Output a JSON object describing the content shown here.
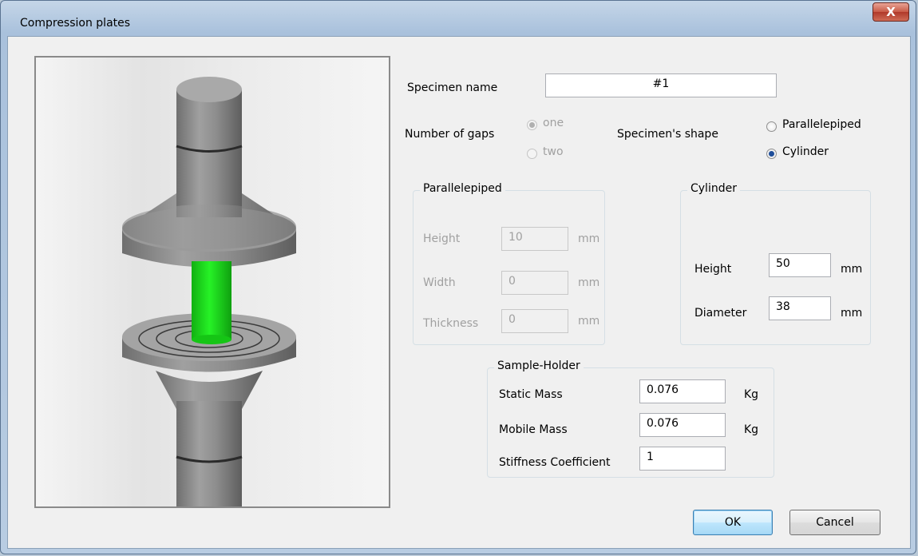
{
  "window": {
    "title": "Compression plates",
    "close_label": "X"
  },
  "specimen": {
    "label": "Specimen name",
    "value": "#1"
  },
  "gaps": {
    "label": "Number of gaps",
    "options": [
      "one",
      "two"
    ],
    "selected": "one"
  },
  "shape": {
    "label": "Specimen's shape",
    "options": [
      "Parallelepiped",
      "Cylinder"
    ],
    "selected": "Cylinder"
  },
  "parallelepiped": {
    "title": "Parallelepiped",
    "height_label": "Height",
    "height_value": "10",
    "width_label": "Width",
    "width_value": "0",
    "thickness_label": "Thickness",
    "thickness_value": "0",
    "unit": "mm"
  },
  "cylinder": {
    "title": "Cylinder",
    "height_label": "Height",
    "height_value": "50",
    "diameter_label": "Diameter",
    "diameter_value": "38",
    "unit": "mm"
  },
  "sample_holder": {
    "title": "Sample-Holder",
    "static_label": "Static Mass",
    "static_value": "0.076",
    "mobile_label": "Mobile Mass",
    "mobile_value": "0.076",
    "stiffness_label": "Stiffness Coefficient",
    "stiffness_value": "1",
    "mass_unit": "Kg"
  },
  "buttons": {
    "ok": "OK",
    "cancel": "Cancel"
  },
  "colors": {
    "specimen": "#19e619",
    "plate": "#8c8c8c"
  }
}
